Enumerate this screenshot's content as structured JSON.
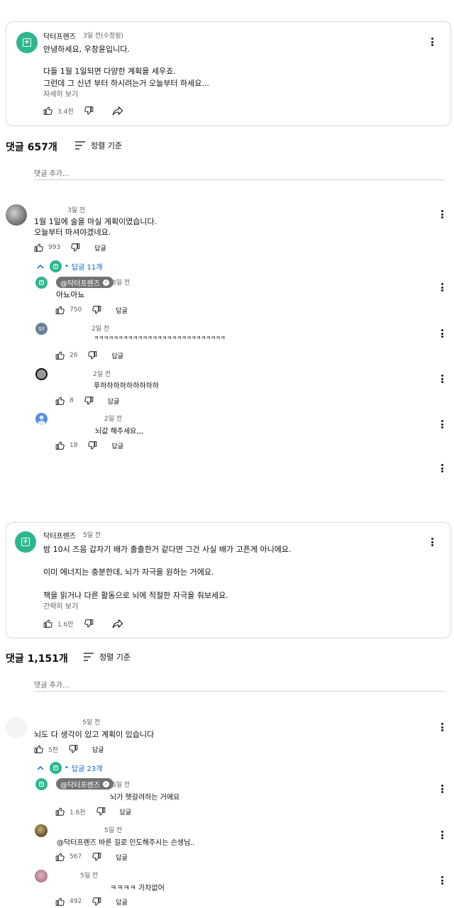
{
  "post1": {
    "channel": "닥터프렌즈",
    "time": "3일 전(수정됨)",
    "lines": [
      "안녕하세요, 우창윤입니다.",
      "다들 1월 1일되면 다양한 계획을 세우죠.",
      "그런데 그 신년 부터 하시려는거 오늘부터 하세요..."
    ],
    "more": "자세히 보기",
    "likes": "3.4천"
  },
  "section1": {
    "count": "댓글 657개",
    "sort": "정렬 기준",
    "add_placeholder": "댓글 추가..."
  },
  "c1": {
    "time": "3일 전",
    "lines": [
      "1월 1일에 술을 마실 계획이였습니다.",
      "오늘부터 마셔야겠네요."
    ],
    "likes": "993",
    "reply": "답글",
    "replies": "답글 11개"
  },
  "r1": {
    "author": "@닥터프렌즈",
    "time": "3일 전",
    "text": "아뇨아뇨",
    "likes": "750",
    "reply": "답글"
  },
  "r2": {
    "avatar_text": "SY",
    "time": "2일 전",
    "text": "ㅋㅋㅋㅋㅋㅋㅋㅋㅋㅋㅋㅋㅋㅋㅋㅋㅋㅋㅋㅋㅋㅋㅋㅋㅋㅋㅋ",
    "likes": "26",
    "reply": "답글"
  },
  "r3": {
    "time": "2일 전",
    "text": "푸하하하하하하하하하",
    "likes": "8",
    "reply": "답글"
  },
  "r4": {
    "time": "2일 전",
    "text": "뇌값 해주세요,,,",
    "likes": "18",
    "reply": "답글"
  },
  "post2": {
    "channel": "닥터프렌즈",
    "time": "5일 전",
    "lines": [
      "밤 10시 즈음 갑자기 배가 출출한거 같다면 그건 사실 배가 고픈게 아니에요.",
      "이미 에너지는 충분한데, 뇌가 자극을 원하는 거에요.",
      "책을 읽거나 다른 활동으로 뇌에 적절한 자극을 줘보세요."
    ],
    "less": "간략히 보기",
    "likes": "1.6만"
  },
  "section2": {
    "count": "댓글 1,151개",
    "sort": "정렬 기준",
    "add_placeholder": "댓글 추가..."
  },
  "c2": {
    "time": "5일 전",
    "text": "뇌도 다 생각이 있고 계획이 있습니다",
    "likes": "5천",
    "reply": "답글",
    "replies": "답글 23개"
  },
  "r5": {
    "author": "@닥터프렌즈",
    "time": "5일 전",
    "text": "뇌가 헷갈려하는 거에요",
    "likes": "1.6천",
    "reply": "답글"
  },
  "r6": {
    "time": "5일 전",
    "text": "@닥터프렌즈  바른 길로 인도해주시는 슨생님..",
    "likes": "567",
    "reply": "답글"
  },
  "r7": {
    "time": "5일 전",
    "text": "ㅋㅋㅋㅋ 가차없어",
    "likes": "492",
    "reply": "답글"
  },
  "colors": {
    "brand": "#2db68d",
    "link": "#065fd4",
    "pill": "#737373"
  }
}
